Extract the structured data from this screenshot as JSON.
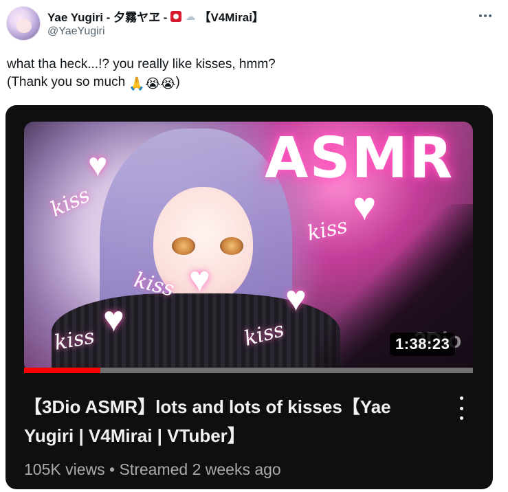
{
  "author": {
    "display_name": "Yae Yugiri - 夕霧ヤヱ -",
    "tag": "【V4Mirai】",
    "handle": "@YaeYugiri",
    "badges": [
      "red-square-badge-icon",
      "cloud-icon"
    ]
  },
  "tweet": {
    "line1": "what tha heck...!? you really like kisses, hmm?",
    "line2_prefix": "(Thank you so much ",
    "emojis": [
      "🙏",
      "😭",
      "😭"
    ],
    "line2_suffix": ")"
  },
  "video": {
    "thumbnail": {
      "title_text": "ASMR",
      "stickers": [
        "kiss",
        "kiss",
        "kiss",
        "kiss",
        "kiss"
      ],
      "watermark": "3Dio"
    },
    "duration": "1:38:23",
    "progress": 0.17,
    "title_line1": "【3Dio ASMR】lots and lots of kisses【Yae",
    "title_line2": "Yugiri | V4Mirai | VTuber】",
    "views": "105K views",
    "separator": "•",
    "streamed": "Streamed 2 weeks ago"
  },
  "colors": {
    "card_bg": "#0f0f0f",
    "progress_red": "#ff0000",
    "meta_gray": "#aaaaaa",
    "handle_gray": "#536471"
  }
}
